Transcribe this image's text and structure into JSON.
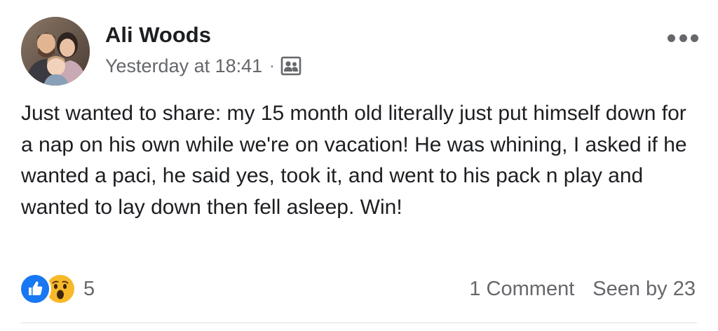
{
  "post": {
    "author": "Ali Woods",
    "timestamp": "Yesterday at 18:41",
    "separator": "·",
    "audience_icon": "friends-audience-icon",
    "body": "Just wanted to share: my 15 month old literally just put himself down for a nap on his own while we're on vacation! He was whining, I asked if he wanted a paci, he said yes, took it, and went to his pack n play and wanted to lay down then fell asleep. Win!",
    "reactions": {
      "types": [
        "like",
        "wow"
      ],
      "count": "5"
    },
    "comments_label": "1 Comment",
    "seen_label": "Seen by 23"
  },
  "colors": {
    "text": "#1c1e21",
    "secondary_text": "#65676b",
    "like_blue": "#1877f2",
    "wow_yellow": "#f7b928",
    "divider": "#dadde1"
  }
}
